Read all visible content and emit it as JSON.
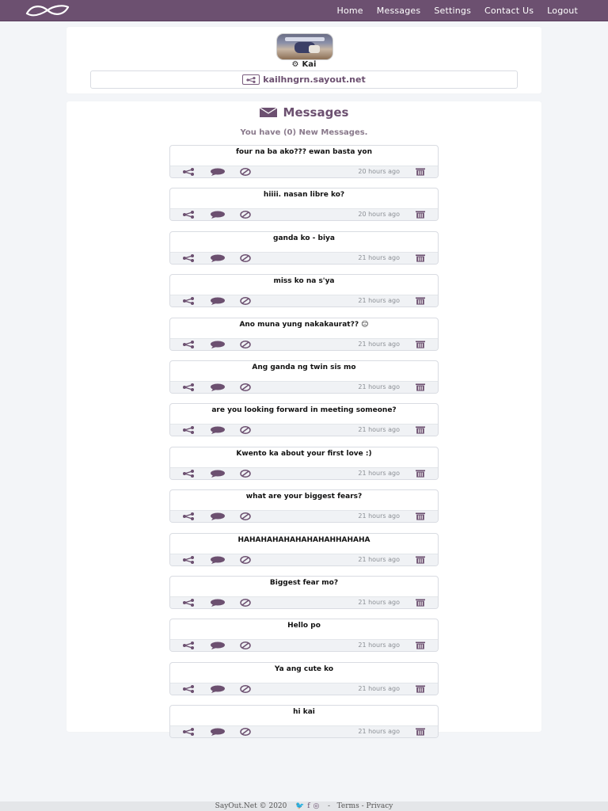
{
  "nav": {
    "links": [
      "Home",
      "Messages",
      "Settings",
      "Contact Us",
      "Logout"
    ]
  },
  "profile": {
    "name": "Kai",
    "link": "kailhngrn.sayout.net"
  },
  "messages": {
    "title": "Messages",
    "new_count_text": "You have (0) New Messages.",
    "items": [
      {
        "text": "four na ba ako??? ewan basta yon",
        "time": "20 hours ago"
      },
      {
        "text": "hiiii. nasan libre ko?",
        "time": "20 hours ago"
      },
      {
        "text": "ganda ko - biya",
        "time": "21 hours ago"
      },
      {
        "text": "miss ko na s'ya",
        "time": "21 hours ago"
      },
      {
        "text": "Ano muna yung nakakaurat?? 😑",
        "time": "21 hours ago"
      },
      {
        "text": "Ang ganda ng twin sis mo",
        "time": "21 hours ago"
      },
      {
        "text": "are you looking forward in meeting someone?",
        "time": "21 hours ago"
      },
      {
        "text": "Kwento ka about your first love :)",
        "time": "21 hours ago"
      },
      {
        "text": "what are your biggest fears?",
        "time": "21 hours ago"
      },
      {
        "text": "HAHAHAHAHAHAHAHAHHAHAHA",
        "time": "21 hours ago"
      },
      {
        "text": "Biggest fear mo?",
        "time": "21 hours ago"
      },
      {
        "text": "Hello po",
        "time": "21 hours ago"
      },
      {
        "text": "Ya ang cute ko",
        "time": "21 hours ago"
      },
      {
        "text": "hi kai",
        "time": "21 hours ago"
      }
    ]
  },
  "footer": {
    "copyright": "SayOut.Net © 2020",
    "separator": "-",
    "terms": "Terms",
    "dash": "-",
    "privacy": "Privacy"
  },
  "colors": {
    "brand": "#6c5070",
    "background": "#f3f5f8"
  },
  "icons": {
    "logo": "infinity-logo",
    "share": "share-icon",
    "reply": "comment-icon",
    "block": "ban-icon",
    "delete": "trash-icon",
    "settings": "gear-icon",
    "messages": "envelope-icon"
  }
}
